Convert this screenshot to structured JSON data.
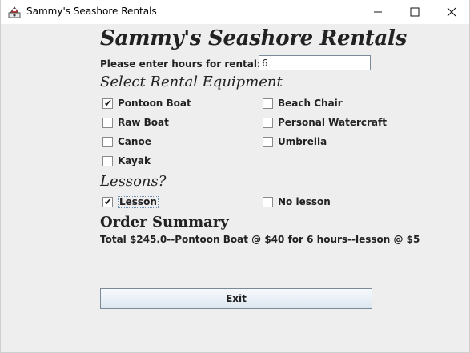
{
  "window": {
    "title": "Sammy's Seashore Rentals",
    "icon": "java-app-icon",
    "controls": [
      "minimize-icon",
      "maximize-icon",
      "close-icon"
    ]
  },
  "app": {
    "title": "Sammy's Seashore Rentals"
  },
  "hours": {
    "label": "Please enter hours for rental:",
    "value": "6"
  },
  "equipment": {
    "heading": "Select Rental Equipment",
    "items": [
      {
        "label": "Pontoon Boat",
        "checked": true
      },
      {
        "label": "Beach Chair",
        "checked": false
      },
      {
        "label": "Raw Boat",
        "checked": false
      },
      {
        "label": "Personal Watercraft",
        "checked": false
      },
      {
        "label": "Canoe",
        "checked": false
      },
      {
        "label": "Umbrella",
        "checked": false
      },
      {
        "label": "Kayak",
        "checked": false
      }
    ]
  },
  "lessons": {
    "heading": "Lessons?",
    "items": [
      {
        "label": "Lesson",
        "checked": true,
        "focused": true
      },
      {
        "label": "No lesson",
        "checked": false
      }
    ]
  },
  "summary": {
    "heading": "Order Summary",
    "text": "Total $245.0--Pontoon Boat @ $40 for 6 hours--lesson @ $5"
  },
  "exit_label": "Exit",
  "colors": {
    "background": "#eeeeee",
    "button_border": "#7a8a99",
    "focus_border": "#6d8fb3"
  }
}
